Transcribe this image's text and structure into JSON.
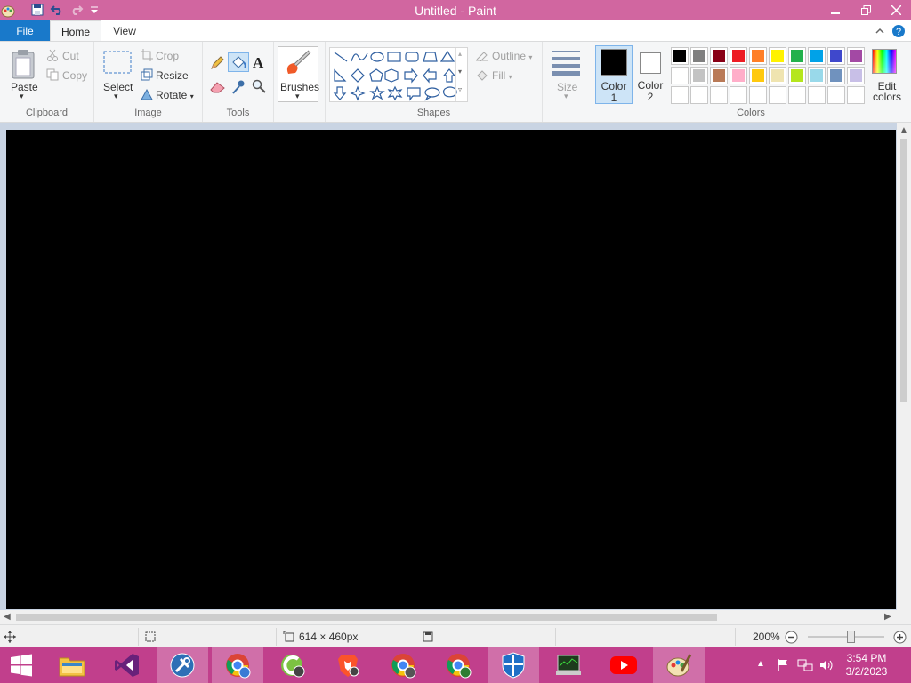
{
  "window": {
    "title": "Untitled - Paint"
  },
  "tabs": {
    "file": "File",
    "home": "Home",
    "view": "View"
  },
  "clipboard": {
    "paste": "Paste",
    "cut": "Cut",
    "copy": "Copy",
    "label": "Clipboard"
  },
  "image": {
    "select": "Select",
    "crop": "Crop",
    "resize": "Resize",
    "rotate": "Rotate",
    "label": "Image"
  },
  "tools": {
    "label": "Tools"
  },
  "brushes": {
    "label": "Brushes"
  },
  "shapes": {
    "outline": "Outline",
    "fill": "Fill",
    "label": "Shapes"
  },
  "size": {
    "label": "Size"
  },
  "colors": {
    "color1_line1": "Color",
    "color1_line2": "1",
    "color2_line1": "Color",
    "color2_line2": "2",
    "edit_line1": "Edit",
    "edit_line2": "colors",
    "label": "Colors",
    "color1": "#000000",
    "color2": "#ffffff",
    "palette_row1": [
      "#000000",
      "#7f7f7f",
      "#880015",
      "#ed1c24",
      "#ff7f27",
      "#fff200",
      "#22b14c",
      "#00a2e8",
      "#3f48cc",
      "#a349a4"
    ],
    "palette_row2": [
      "#ffffff",
      "#c3c3c3",
      "#b97a57",
      "#ffaec9",
      "#ffc90e",
      "#efe4b0",
      "#b5e61d",
      "#99d9ea",
      "#7092be",
      "#c8bfe7"
    ]
  },
  "status": {
    "dimensions": "614 × 460px",
    "zoom": "200%"
  },
  "clock": {
    "time": "3:54 PM",
    "date": "3/2/2023"
  }
}
